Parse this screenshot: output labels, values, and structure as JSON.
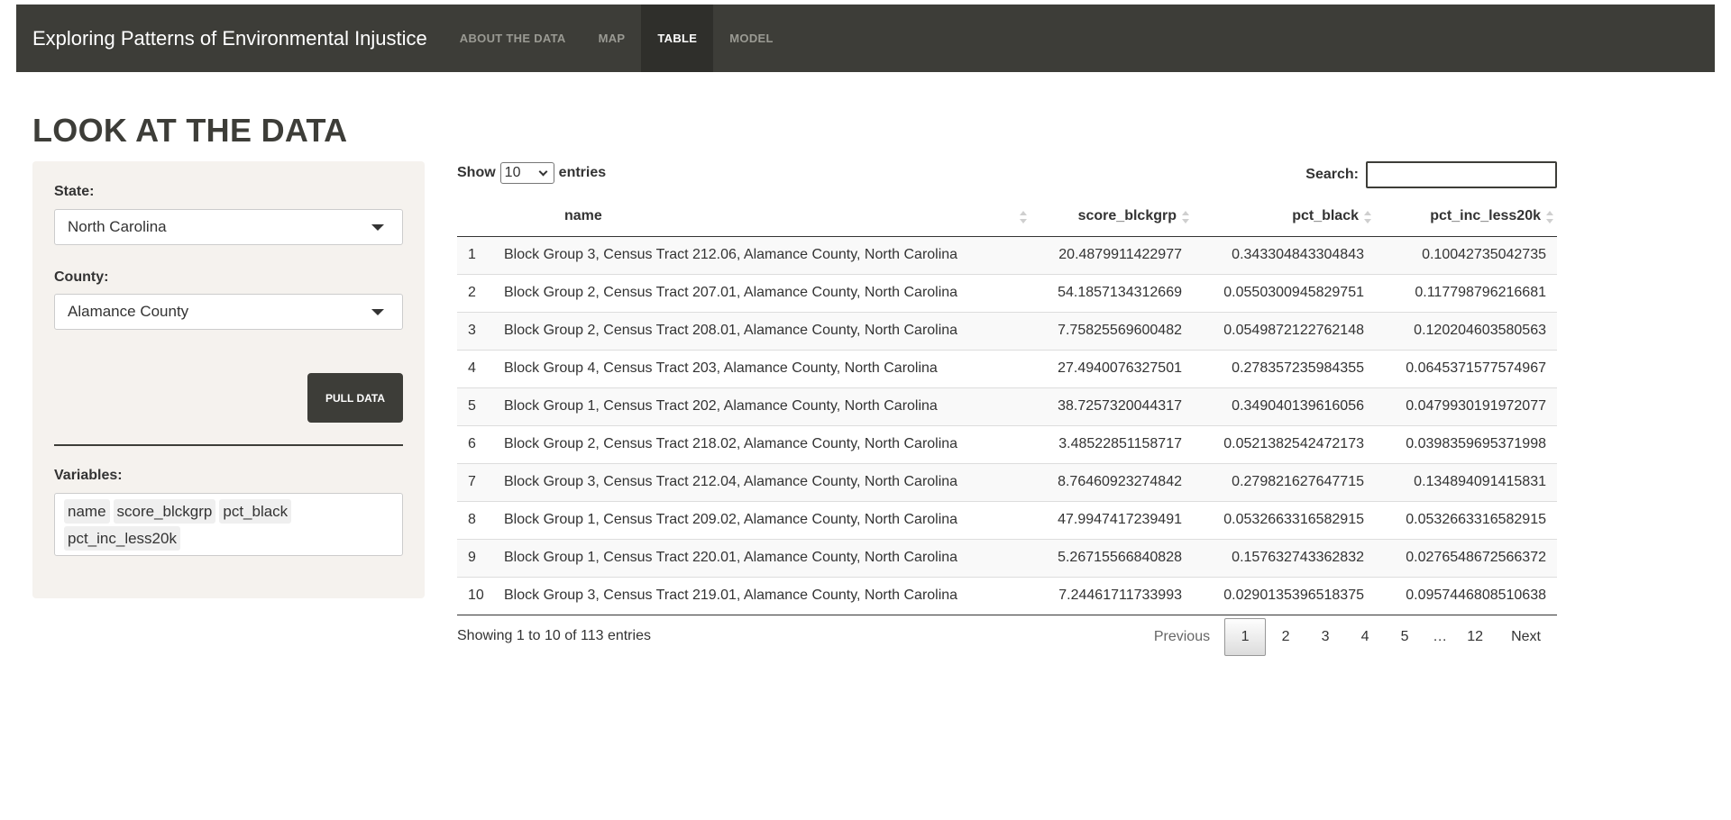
{
  "app": {
    "brand": "Exploring Patterns of Environmental Injustice",
    "nav": [
      "ABOUT THE DATA",
      "MAP",
      "TABLE",
      "MODEL"
    ],
    "active_nav": "TABLE"
  },
  "page_title": "LOOK AT THE DATA",
  "sidebar": {
    "state_label": "State:",
    "state_value": "North Carolina",
    "county_label": "County:",
    "county_value": "Alamance County",
    "pull_button": "PULL DATA",
    "variables_label": "Variables:",
    "variables": [
      "name",
      "score_blckgrp",
      "pct_black",
      "pct_inc_less20k"
    ]
  },
  "table_controls": {
    "show_label": "Show",
    "entries_value": "10",
    "entries_label": "entries",
    "search_label": "Search:",
    "search_value": ""
  },
  "table": {
    "columns": [
      "",
      "name",
      "score_blckgrp",
      "pct_black",
      "pct_inc_less20k"
    ],
    "rows": [
      [
        "1",
        "Block Group 3, Census Tract 212.06, Alamance County, North Carolina",
        "20.4879911422977",
        "0.343304843304843",
        "0.10042735042735"
      ],
      [
        "2",
        "Block Group 2, Census Tract 207.01, Alamance County, North Carolina",
        "54.1857134312669",
        "0.0550300945829751",
        "0.117798796216681"
      ],
      [
        "3",
        "Block Group 2, Census Tract 208.01, Alamance County, North Carolina",
        "7.75825569600482",
        "0.0549872122762148",
        "0.120204603580563"
      ],
      [
        "4",
        "Block Group 4, Census Tract 203, Alamance County, North Carolina",
        "27.4940076327501",
        "0.278357235984355",
        "0.0645371577574967"
      ],
      [
        "5",
        "Block Group 1, Census Tract 202, Alamance County, North Carolina",
        "38.7257320044317",
        "0.349040139616056",
        "0.0479930191972077"
      ],
      [
        "6",
        "Block Group 2, Census Tract 218.02, Alamance County, North Carolina",
        "3.48522851158717",
        "0.0521382542472173",
        "0.0398359695371998"
      ],
      [
        "7",
        "Block Group 3, Census Tract 212.04, Alamance County, North Carolina",
        "8.76460923274842",
        "0.279821627647715",
        "0.134894091415831"
      ],
      [
        "8",
        "Block Group 1, Census Tract 209.02, Alamance County, North Carolina",
        "47.9947417239491",
        "0.0532663316582915",
        "0.0532663316582915"
      ],
      [
        "9",
        "Block Group 1, Census Tract 220.01, Alamance County, North Carolina",
        "5.26715566840828",
        "0.157632743362832",
        "0.0276548672566372"
      ],
      [
        "10",
        "Block Group 3, Census Tract 219.01, Alamance County, North Carolina",
        "7.24461711733993",
        "0.0290135396518375",
        "0.0957446808510638"
      ]
    ]
  },
  "footer": {
    "info": "Showing 1 to 10 of 113 entries",
    "pagination": [
      "Previous",
      "1",
      "2",
      "3",
      "4",
      "5",
      "…",
      "12",
      "Next"
    ],
    "current_page": "1"
  }
}
